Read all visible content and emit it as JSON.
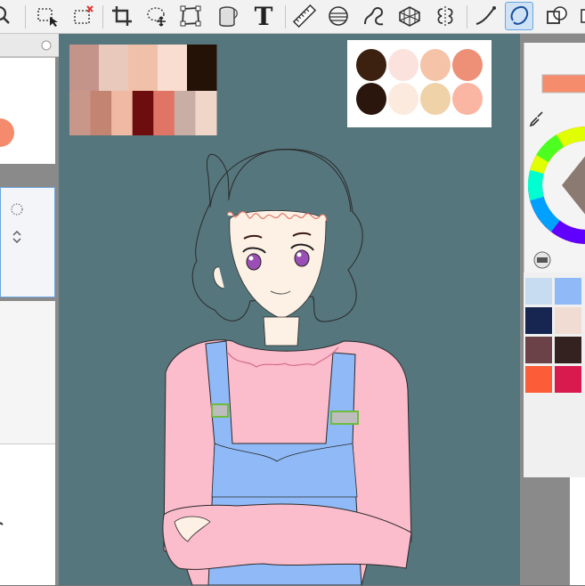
{
  "toolbar": {
    "tools": [
      {
        "icon": "zoom-icon"
      },
      {
        "icon": "rectangle-select-icon"
      },
      {
        "icon": "select-clear-icon"
      },
      {
        "icon": "crop-icon"
      },
      {
        "icon": "lasso-move-icon"
      },
      {
        "icon": "transform-icon"
      },
      {
        "icon": "bucket-icon"
      },
      {
        "icon": "text-tool-icon"
      },
      {
        "icon": "ruler-icon"
      },
      {
        "icon": "figure-icon"
      },
      {
        "icon": "curve-icon"
      },
      {
        "icon": "perspective-grid-icon"
      },
      {
        "icon": "symmetry-icon"
      },
      {
        "icon": "pen-stroke-icon"
      },
      {
        "icon": "ellipse-icon"
      },
      {
        "icon": "layer-icon"
      }
    ],
    "text_tool_glyph": "T",
    "active_tool": "ellipse-icon"
  },
  "reference_palette_left": {
    "top_row": [
      "#c4938a",
      "#e9c9bb",
      "#f0c0a8",
      "#f9ddd0",
      "#241207"
    ],
    "bottom_row": [
      "#c8978a",
      "#c48472",
      "#f0b9a4",
      "#6e0d0d",
      "#e07565",
      "#c9aea6",
      "#efd6c9"
    ]
  },
  "reference_palette_right": {
    "top_row": [
      "#3c2010",
      "#fbe2dc",
      "#f5c3a8",
      "#ee8f78"
    ],
    "bottom_row": [
      "#2a160d",
      "#fdeade",
      "#f0d2a8",
      "#fbb5a3"
    ]
  },
  "color_panel": {
    "current_color": "#f58c6c",
    "eyedropper_icon": "eyedropper-icon"
  },
  "swatch_grid": [
    [
      "#c7dcf0",
      "#8fbaf7"
    ],
    [
      "#162650",
      "#f0dcd2"
    ],
    [
      "#6b4248",
      "#332220"
    ],
    [
      "#fc5c38",
      "#d81a4f"
    ]
  ],
  "left_panel": {
    "preview_color": "#f48b6c"
  }
}
